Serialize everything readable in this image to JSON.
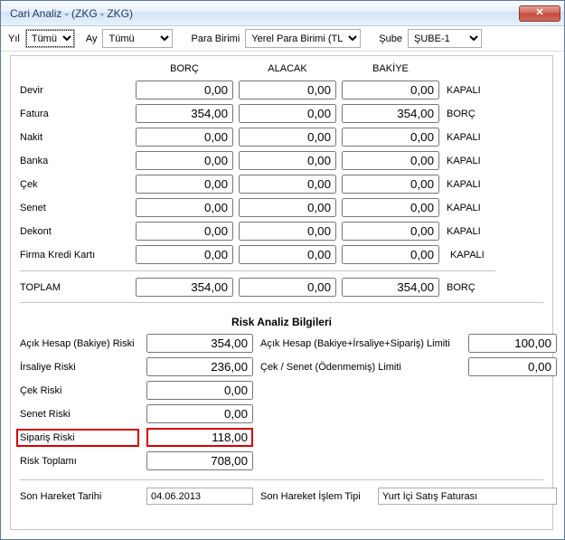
{
  "window": {
    "title": "Cari Analiz  - (ZKG - ZKG)"
  },
  "filters": {
    "yil_label": "Yıl",
    "yil_value": "Tümü",
    "ay_label": "Ay",
    "ay_value": "Tümü",
    "para_label": "Para Birimi",
    "para_value": "Yerel Para Birimi (TL)",
    "sube_label": "Şube",
    "sube_value": "ŞUBE-1"
  },
  "headers": {
    "borc": "BORÇ",
    "alacak": "ALACAK",
    "bakiye": "BAKİYE"
  },
  "rows": {
    "devir": {
      "label": "Devir",
      "borc": "0,00",
      "alacak": "0,00",
      "bakiye": "0,00",
      "status": "KAPALI"
    },
    "fatura": {
      "label": "Fatura",
      "borc": "354,00",
      "alacak": "0,00",
      "bakiye": "354,00",
      "status": "BORÇ"
    },
    "nakit": {
      "label": "Nakit",
      "borc": "0,00",
      "alacak": "0,00",
      "bakiye": "0,00",
      "status": "KAPALI"
    },
    "banka": {
      "label": "Banka",
      "borc": "0,00",
      "alacak": "0,00",
      "bakiye": "0,00",
      "status": "KAPALI"
    },
    "cek": {
      "label": "Çek",
      "borc": "0,00",
      "alacak": "0,00",
      "bakiye": "0,00",
      "status": "KAPALI"
    },
    "senet": {
      "label": "Senet",
      "borc": "0,00",
      "alacak": "0,00",
      "bakiye": "0,00",
      "status": "KAPALI"
    },
    "dekont": {
      "label": "Dekont",
      "borc": "0,00",
      "alacak": "0,00",
      "bakiye": "0,00",
      "status": "KAPALI"
    },
    "firmakk": {
      "label": "Firma Kredi Kartı",
      "borc": "0,00",
      "alacak": "0,00",
      "bakiye": "0,00",
      "status": "KAPALI"
    },
    "toplam": {
      "label": "TOPLAM",
      "borc": "354,00",
      "alacak": "0,00",
      "bakiye": "354,00",
      "status": "BORÇ"
    }
  },
  "risk": {
    "title": "Risk Analiz Bilgileri",
    "acik_hesap_label": "Açık Hesap (Bakiye) Riski",
    "acik_hesap_value": "354,00",
    "limit1_label": "Açık Hesap (Bakiye+İrsaliye+Sipariş) Limiti",
    "limit1_value": "100,00",
    "irsaliye_label": "İrsaliye Riski",
    "irsaliye_value": "236,00",
    "limit2_label": "Çek / Senet (Ödenmemiş) Limiti",
    "limit2_value": "0,00",
    "cek_label": "Çek Riski",
    "cek_value": "0,00",
    "senet_label": "Senet Riski",
    "senet_value": "0,00",
    "siparis_label": "Sipariş Riski",
    "siparis_value": "118,00",
    "toplam_label": "Risk Toplamı",
    "toplam_value": "708,00"
  },
  "bottom": {
    "tarih_label": "Son Hareket Tarihi",
    "tarih_value": "04.06.2013",
    "tip_label": "Son Hareket İşlem Tipi",
    "tip_value": "Yurt İçi Satış Faturası"
  }
}
